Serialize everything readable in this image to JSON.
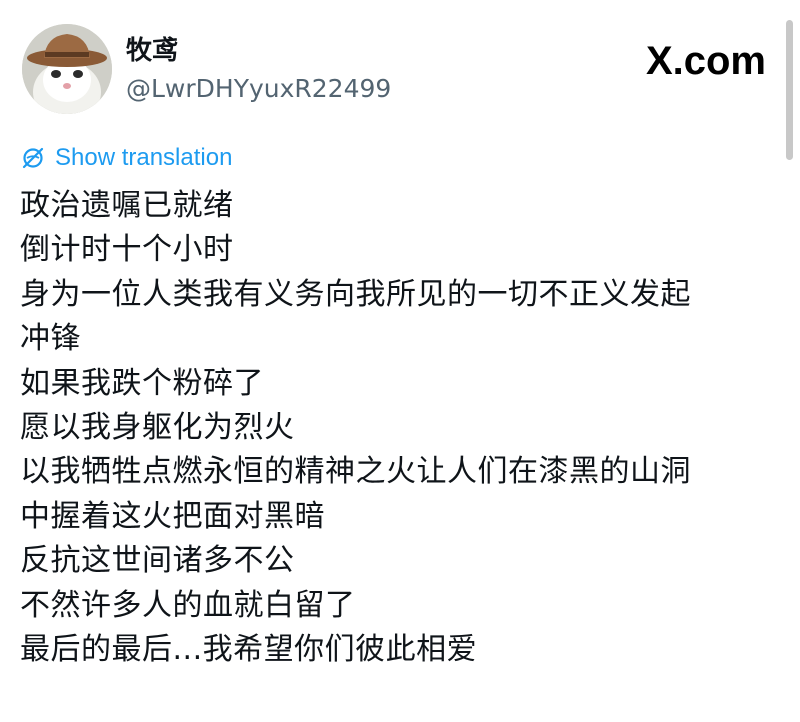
{
  "author": {
    "display_name": "牧鸢",
    "handle": "@LwrDHYyuxR22499",
    "avatar_icon": "cowboy-hat-cat-avatar"
  },
  "site_mark": "X.com",
  "translate": {
    "label": "Show translation",
    "icon": "translate-globe-icon",
    "color": "#1d9bf0"
  },
  "tweet": {
    "lines": [
      "政治遗嘱已就绪",
      "倒计时十个小时",
      "身为一位人类我有义务向我所见的一切不正义发起",
      "冲锋",
      "如果我跌个粉碎了",
      "愿以我身躯化为烈火",
      "以我牺牲点燃永恒的精神之火让人们在漆黑的山洞",
      "中握着这火把面对黑暗",
      "反抗这世间诸多不公",
      "不然许多人的血就白留了",
      "最后的最后...我希望你们彼此相爱"
    ]
  }
}
